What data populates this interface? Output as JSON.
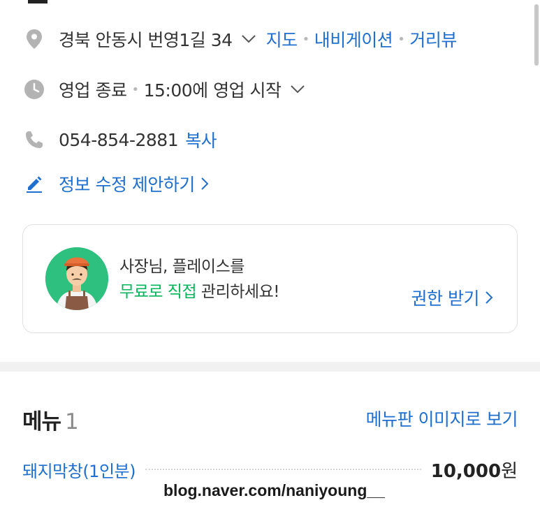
{
  "address": {
    "text": "경북 안동시 번영1길 34",
    "links": [
      "지도",
      "내비게이션",
      "거리뷰"
    ]
  },
  "hours": {
    "status": "영업 종료",
    "next": "15:00에 영업 시작"
  },
  "phone": {
    "number": "054-854-2881",
    "copy_label": "복사"
  },
  "suggest_edit_label": "정보 수정 제안하기",
  "owner_card": {
    "line1": "사장님, 플레이스를",
    "line2_green": "무료로 직접",
    "line2_rest": " 관리하세요!",
    "link_label": "권한 받기"
  },
  "menu": {
    "title": "메뉴",
    "count": "1",
    "image_link": "메뉴판 이미지로 보기",
    "items": [
      {
        "name": "돼지막창(1인분)",
        "price": "10,000",
        "unit": "원"
      }
    ]
  },
  "watermark": "blog.naver.com/naniyoung__",
  "colors": {
    "link": "#1e6fcf",
    "green": "#03b65a",
    "icon_gray": "#b3b3b3",
    "text": "#333333"
  },
  "icons": {
    "address": "map-pin-icon",
    "hours": "clock-icon",
    "phone": "phone-icon",
    "suggest": "pencil-icon"
  }
}
